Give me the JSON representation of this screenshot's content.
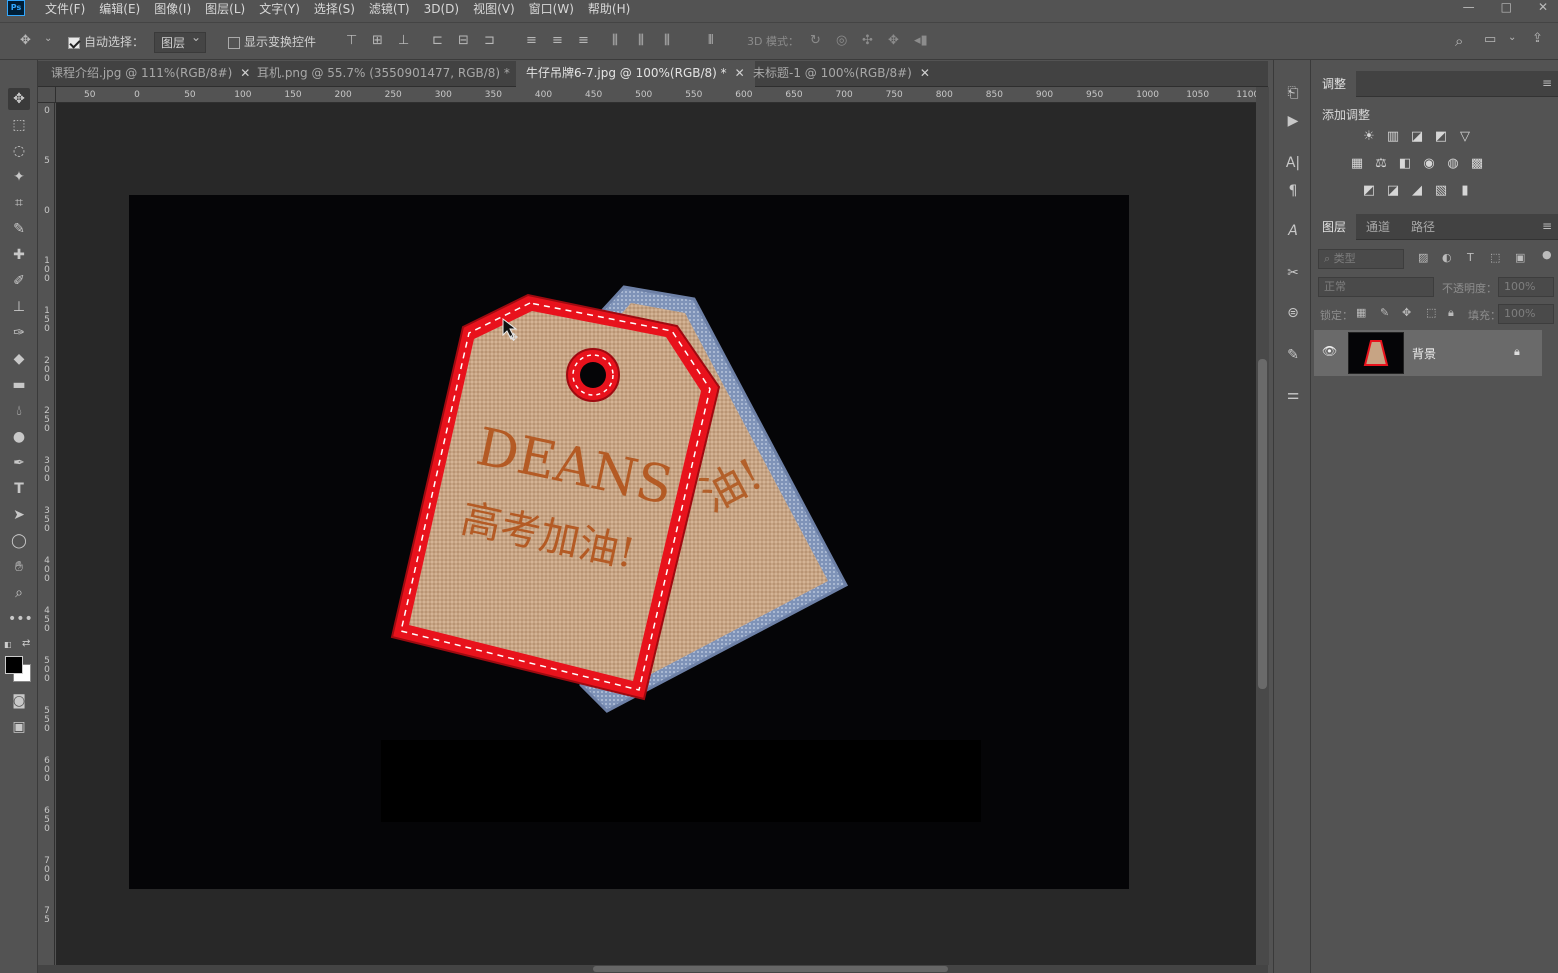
{
  "app": {
    "logo": "Ps"
  },
  "menu": [
    "文件(F)",
    "编辑(E)",
    "图像(I)",
    "图层(L)",
    "文字(Y)",
    "选择(S)",
    "滤镜(T)",
    "3D(D)",
    "视图(V)",
    "窗口(W)",
    "帮助(H)"
  ],
  "window_controls": [
    "—",
    "□",
    "✕"
  ],
  "options": {
    "auto_select_label": "自动选择：",
    "auto_select_value": "图层",
    "show_transform_label": "显示变换控件",
    "mode_3d_label": "3D 模式："
  },
  "tabs": [
    {
      "label": "课程介绍.jpg @ 111%(RGB/8#)",
      "close": "✕"
    },
    {
      "label": "耳机.png @ 55.7% (3550901477, RGB/8) *",
      "close": "✕"
    },
    {
      "label": "牛仔吊牌6-7.jpg @ 100%(RGB/8) *",
      "close": "✕"
    },
    {
      "label": "未标题-1 @ 100%(RGB/8#)",
      "close": "✕"
    }
  ],
  "ruler_top": [
    "50",
    "0",
    "50",
    "100",
    "150",
    "200",
    "250",
    "300",
    "350",
    "400",
    "450",
    "500",
    "550",
    "600",
    "650",
    "700",
    "750",
    "800",
    "850",
    "900",
    "950",
    "1000",
    "1050",
    "1100"
  ],
  "ruler_left": [
    "0",
    "5",
    "0",
    "1 0 0",
    "1 5 0",
    "2 0 0",
    "2 5 0",
    "3 0 0",
    "3 5 0",
    "4 0 0",
    "4 5 0",
    "5 0 0",
    "5 5 0",
    "6 0 0",
    "6 5 0",
    "7 0 0",
    "7 5"
  ],
  "canvas_art": {
    "front_text_en": "DEANS",
    "front_text_cn": "高考加油!",
    "back_text": "油!",
    "tag_color": "#e8121c",
    "canvas_color": "#c8a88a",
    "denim_color": "#8ea0c0"
  },
  "adjust_panel": {
    "title": "调整",
    "add_label": "添加调整",
    "row1": [
      "☀",
      "▥",
      "◪",
      "◩",
      "▽"
    ],
    "row2": [
      "▦",
      "⚖",
      "◧",
      "◉",
      "◍",
      "▩"
    ],
    "row3": [
      "◩",
      "◪",
      "◢",
      "▧",
      "▮"
    ]
  },
  "layers_panel": {
    "tabs": [
      "图层",
      "通道",
      "路径"
    ],
    "filter_placeholder": "类型",
    "blend_mode": "正常",
    "opacity_label": "不透明度：",
    "opacity_value": "100%",
    "lock_label": "锁定：",
    "fill_label": "填充：",
    "fill_value": "100%",
    "layers": [
      {
        "name": "背景",
        "visible": true,
        "locked": true
      }
    ]
  }
}
